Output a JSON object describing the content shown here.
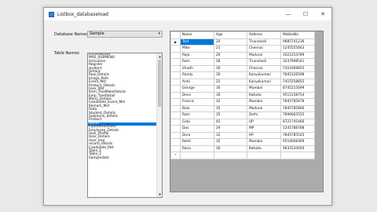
{
  "window": {
    "title": "Listbox_databaseload",
    "minimize": "—",
    "maximize": "☐",
    "close": "✕"
  },
  "labels": {
    "database_names": "Database Names",
    "table_names": "Table Names"
  },
  "database_combo": {
    "value": "Sample",
    "arrow": "▾"
  },
  "table_list": {
    "items": [
      "Listviewsave",
      "MAS_SUBMENU",
      "Activation",
      "Register",
      "student",
      "Details",
      "Row_Details",
      "Image_Path",
      "Event_Mst",
      "Product_Details",
      "User_Mst",
      "Item_TreeMakeDetails",
      "Emp_TreeDetail",
      "Menu_Details",
      "Candidate_Event_Mst",
      "Remark_Mst",
      "Data",
      "Student_Details",
      "Submenu_details",
      "Product",
      "Demo",
      "InputResultData",
      "Employee_Details",
      "User_Profile",
      "User_Details",
      "User_Img",
      "record_details",
      "Candidate_Mst",
      "Table_1",
      "Table_2",
      "Sampledata"
    ],
    "selected_index": 20,
    "scroll_up": "▲",
    "scroll_down": "▼"
  },
  "grid": {
    "columns": [
      "Name",
      "Age",
      "Address",
      "MobileNo"
    ],
    "current_row_marker": "▶",
    "new_row_marker": "*",
    "rows": [
      [
        "Test",
        "20",
        "Tirunelveli",
        "9685741236"
      ],
      [
        "Mike",
        "21",
        "Chennai",
        "1245555663"
      ],
      [
        "Raja",
        "26",
        "Madurai",
        "1021254789"
      ],
      [
        "Ram",
        "28",
        "Tirunelveli",
        "3247698541"
      ],
      [
        "Vinoth",
        "30",
        "Chennai",
        "7410369855"
      ],
      [
        "Randy",
        "30",
        "Kanyakumari",
        "7845126598"
      ],
      [
        "Anto",
        "25",
        "Kanyakumari",
        "7415558855"
      ],
      [
        "George",
        "30",
        "Mumbai",
        "8745215699"
      ],
      [
        "Dees",
        "30",
        "Kolkata",
        "9515158754"
      ],
      [
        "Francis",
        "32",
        "Mumbai",
        "7845785878"
      ],
      [
        "Balu",
        "35",
        "Madurai",
        "7845785866"
      ],
      [
        "Ram",
        "35",
        "Delhi",
        "7896665555"
      ],
      [
        "Gobi",
        "45",
        "UP",
        "8721745466"
      ],
      [
        "Das",
        "29",
        "MP",
        "1245788788"
      ],
      [
        "Dora",
        "32",
        "HP",
        "7845785545"
      ],
      [
        "Rohit",
        "35",
        "Mumbai",
        "9510008369"
      ],
      [
        "Rana",
        "30",
        "Kolkata",
        "9635520000"
      ]
    ]
  }
}
